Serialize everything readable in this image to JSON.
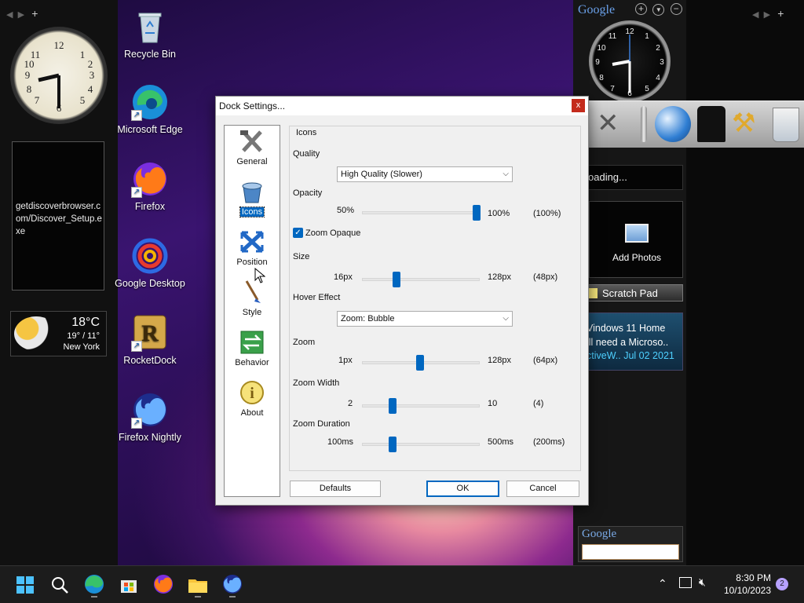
{
  "desktop": {
    "icons": [
      {
        "label": "Recycle Bin",
        "shortcut": false
      },
      {
        "label": "Microsoft Edge",
        "shortcut": true
      },
      {
        "label": "Firefox",
        "shortcut": true
      },
      {
        "label": "Google Desktop",
        "shortcut": false
      },
      {
        "label": "RocketDock",
        "shortcut": true
      },
      {
        "label": "Firefox Nightly",
        "shortcut": true
      }
    ]
  },
  "left_gadgets": {
    "download_text": "getdiscoverbrowser.com/Discover_Setup.exe",
    "weather": {
      "temp": "18°C",
      "range": "19° / 11°",
      "city": "New York"
    }
  },
  "google_sidebar": {
    "logo": "Google",
    "loading_text": "oading...",
    "photos_label": "Add Photos",
    "scratch_pad": "Scratch Pad",
    "news": {
      "line1": "Vindows 11 Home",
      "line2": "ill need a Microso..",
      "line3": "ctiveW.. Jul 02 2021"
    },
    "search_logo": "Google"
  },
  "dialog": {
    "title": "Dock Settings...",
    "close": "x",
    "tabs": [
      {
        "label": "General",
        "icon": "tools-icon"
      },
      {
        "label": "Icons",
        "icon": "icons-icon"
      },
      {
        "label": "Position",
        "icon": "position-icon"
      },
      {
        "label": "Style",
        "icon": "brush-icon"
      },
      {
        "label": "Behavior",
        "icon": "behavior-icon"
      },
      {
        "label": "About",
        "icon": "info-icon"
      }
    ],
    "group_title": "Icons",
    "quality": {
      "label": "Quality",
      "value": "High Quality (Slower)"
    },
    "opacity": {
      "label": "Opacity",
      "min": "50%",
      "max": "100%",
      "current": "(100%)",
      "fraction": 1.0
    },
    "zoom_opaque": {
      "label": "Zoom Opaque",
      "checked": true
    },
    "size": {
      "label": "Size",
      "min": "16px",
      "max": "128px",
      "current": "(48px)",
      "fraction": 0.29
    },
    "hover": {
      "label": "Hover Effect",
      "value": "Zoom: Bubble"
    },
    "zoom": {
      "label": "Zoom",
      "min": "1px",
      "max": "128px",
      "current": "(64px)",
      "fraction": 0.5
    },
    "zoom_width": {
      "label": "Zoom Width",
      "min": "2",
      "max": "10",
      "current": "(4)",
      "fraction": 0.25
    },
    "zoom_duration": {
      "label": "Zoom Duration",
      "min": "100ms",
      "max": "500ms",
      "current": "(200ms)",
      "fraction": 0.25
    },
    "buttons": {
      "defaults": "Defaults",
      "ok": "OK",
      "cancel": "Cancel"
    }
  },
  "taskbar": {
    "time": "8:30 PM",
    "date": "10/10/2023",
    "notification_count": "2"
  },
  "colors": {
    "accent": "#0067c0",
    "taskbar": "#1c1c1c",
    "close": "#c42b1c"
  }
}
